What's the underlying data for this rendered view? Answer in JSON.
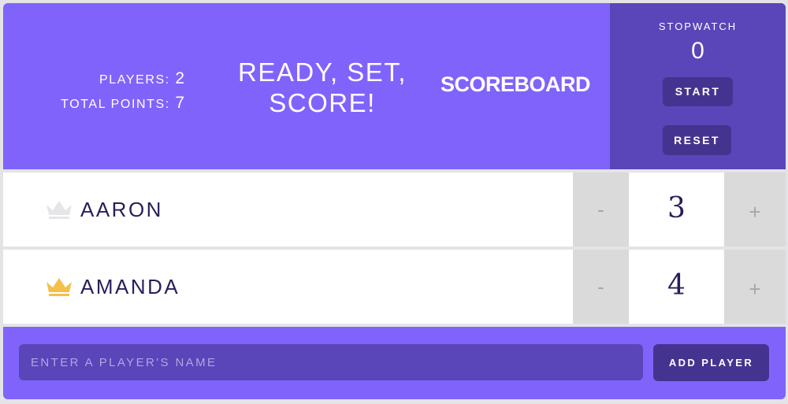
{
  "header": {
    "stats": {
      "players_label": "PLAYERS:",
      "players_value": "2",
      "points_label": "TOTAL POINTS:",
      "points_value": "7"
    },
    "tagline": "READY, SET, SCORE!",
    "title": "SCOREBOARD",
    "stopwatch": {
      "label": "STOPWATCH",
      "time": "0",
      "start_label": "START",
      "reset_label": "RESET"
    }
  },
  "players": [
    {
      "name": "AARON",
      "score": "3",
      "decrement_label": "-",
      "increment_label": "+",
      "crown_icon": "crown-icon",
      "crown_color": "#e6e6e8",
      "is_leader": false
    },
    {
      "name": "AMANDA",
      "score": "4",
      "decrement_label": "-",
      "increment_label": "+",
      "crown_icon": "crown-icon",
      "crown_color": "#f4c04a",
      "is_leader": true
    }
  ],
  "add_player": {
    "placeholder": "ENTER A PLAYER'S NAME",
    "value": "",
    "button_label": "ADD PLAYER"
  },
  "colors": {
    "primary": "#8063fb",
    "secondary": "#5a45b9",
    "button": "#45348f",
    "text_dark": "#2a1d5b",
    "counter_bg": "#dadada",
    "leader_crown": "#f4c04a",
    "inactive_crown": "#e6e6e8"
  }
}
